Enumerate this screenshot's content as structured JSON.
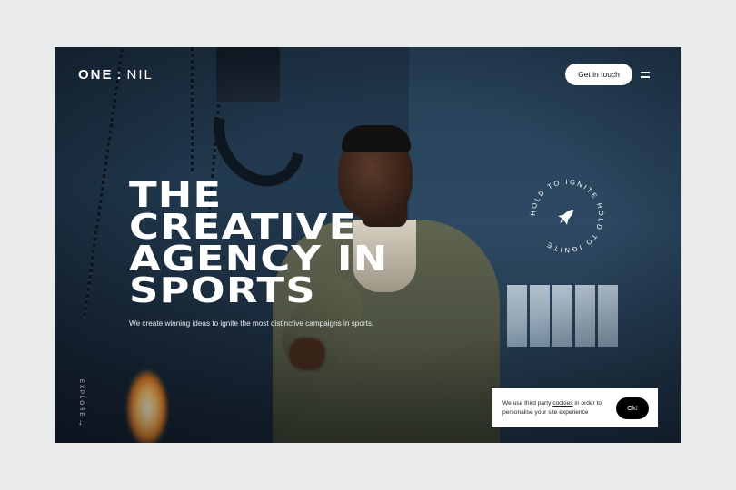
{
  "header": {
    "logo_one": "ONE",
    "logo_sep": ":",
    "logo_nil": "NIL",
    "cta_label": "Get in touch",
    "menu_icon": "hamburger-icon"
  },
  "hero": {
    "headline": [
      "THE",
      "CREATIVE",
      "AGENCY IN",
      "SPORTS"
    ],
    "subline": "We create winning ideas to ignite the most distinctive campaigns in sports."
  },
  "badge": {
    "ring_text": "HOLD TO IGNITE HOLD TO IGNITE ",
    "icon": "rocket-icon"
  },
  "explore": {
    "label": "EXPLORE",
    "icon": "arrow-down-icon"
  },
  "cookie": {
    "text_before": "We use third party ",
    "link": "cookies",
    "text_after": " in order to personalise your site experience",
    "button": "Ok!"
  },
  "colors": {
    "page_bg": "#e9eaec",
    "hero_text": "#ffffff",
    "cta_bg": "#ffffff",
    "cookie_button_bg": "#000000"
  }
}
